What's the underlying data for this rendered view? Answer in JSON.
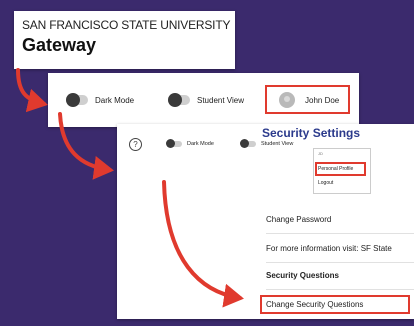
{
  "header": {
    "university": "SAN FRANCISCO STATE UNIVERSITY",
    "app_title": "Gateway"
  },
  "toolbar": {
    "dark_mode_label": "Dark Mode",
    "student_view_label": "Student View",
    "user_name": "John Doe"
  },
  "settings": {
    "title": "Security Settings",
    "help_glyph": "?",
    "dark_mode_label": "Dark Mode",
    "student_view_label": "Student View",
    "menu_avatar_text": "JD",
    "menu": {
      "personal_profile": "Personal Profile",
      "logout": "Logout"
    },
    "rows": {
      "change_password": "Change Password",
      "more_info": "For more information visit: SF State",
      "security_questions": "Security Questions",
      "change_security_questions": "Change Security Questions"
    }
  },
  "colors": {
    "background": "#3b2a6d",
    "highlight": "#e03a2e",
    "title": "#2b3a8c"
  }
}
